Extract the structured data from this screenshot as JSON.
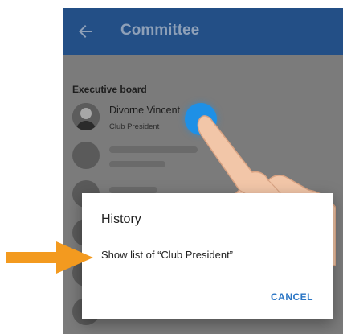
{
  "appbar": {
    "title": "Committee",
    "back_icon": "arrow-left-icon",
    "color": "#234f86"
  },
  "section": {
    "label": "Executive board"
  },
  "member": {
    "name": "Divorne Vincent",
    "role": "Club President"
  },
  "dialog": {
    "title": "History",
    "body": "Show list of “Club President”",
    "cancel_label": "CANCEL",
    "accent": "#2b76c5"
  },
  "overlay": {
    "touch_color": "#1e90e6",
    "arrow_color": "#f39a1f",
    "arrow_icon": "arrow-right-icon",
    "hand_icon": "pointing-hand-icon"
  }
}
